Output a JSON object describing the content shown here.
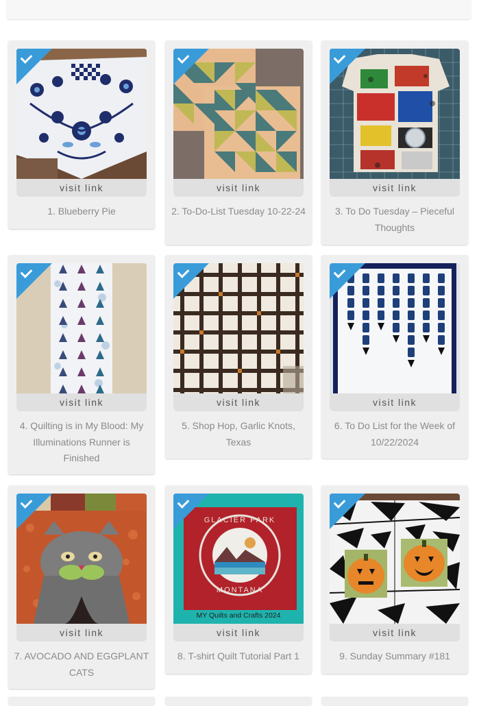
{
  "visit_label": "visit link",
  "accent_color": "#3a9bd9",
  "items": [
    {
      "caption": "1. Blueberry Pie"
    },
    {
      "caption": "2. To-Do-List Tuesday 10-22-24"
    },
    {
      "caption": "3. To Do Tuesday – Pieceful Thoughts"
    },
    {
      "caption": "4. Quilting is in My Blood: My Illuminations Runner is Finished"
    },
    {
      "caption": "5. Shop Hop, Garlic Knots, Texas"
    },
    {
      "caption": "6. To Do List for the Week of 10/22/2024"
    },
    {
      "caption": "7. AVOCADO AND EGGPLANT CATS"
    },
    {
      "caption": "8. T-shirt Quilt Tutorial Part 1",
      "image_text": [
        "GLACIER PARK",
        "MONTANA",
        "MY Quilts and Crafts 2024"
      ]
    },
    {
      "caption": "9. Sunday Summary #181"
    }
  ]
}
